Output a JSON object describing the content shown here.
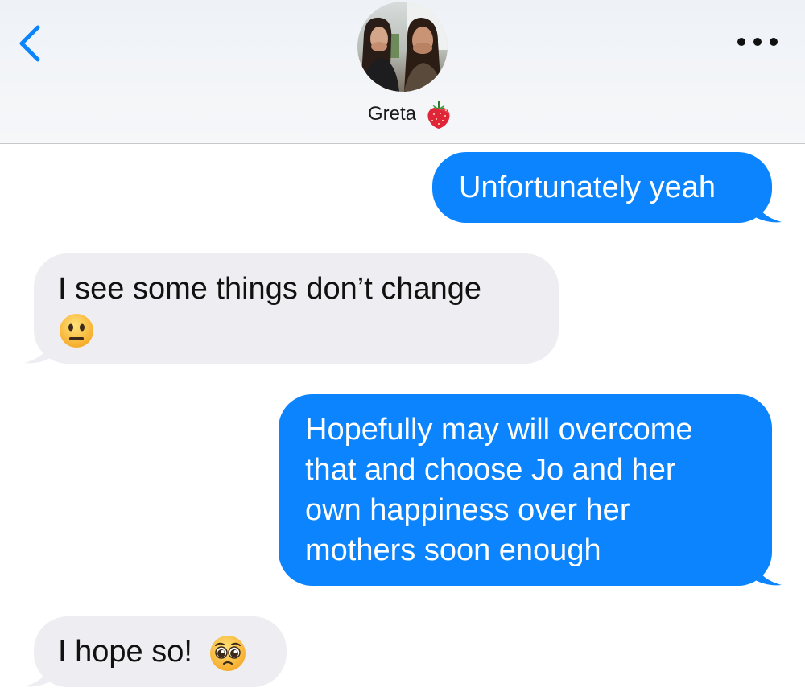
{
  "header": {
    "back_icon": "chevron-left-icon",
    "more_icon": "ellipsis-icon",
    "contact": {
      "name": "Greta",
      "name_emoji": "strawberry-icon",
      "avatar": "contact-photo-two-women-covering-mouths"
    }
  },
  "colors": {
    "accent": "#0b84fe",
    "sent_bubble": "#0b84fe",
    "received_bubble": "#eeeef2",
    "header_bg": "#f4f5f7"
  },
  "messages": [
    {
      "direction": "sent",
      "lines": [
        "Unfortunately yeah"
      ]
    },
    {
      "direction": "received",
      "lines": [
        "I see some things don’t change"
      ],
      "emoji": "neutral-face-emoji"
    },
    {
      "direction": "sent",
      "lines": [
        "Hopefully may will overcome",
        "that and choose Jo and her",
        "own happiness over her",
        "mothers soon enough"
      ]
    },
    {
      "direction": "received",
      "lines": [
        "I hope so!"
      ],
      "emoji": "pleading-face-emoji"
    }
  ]
}
